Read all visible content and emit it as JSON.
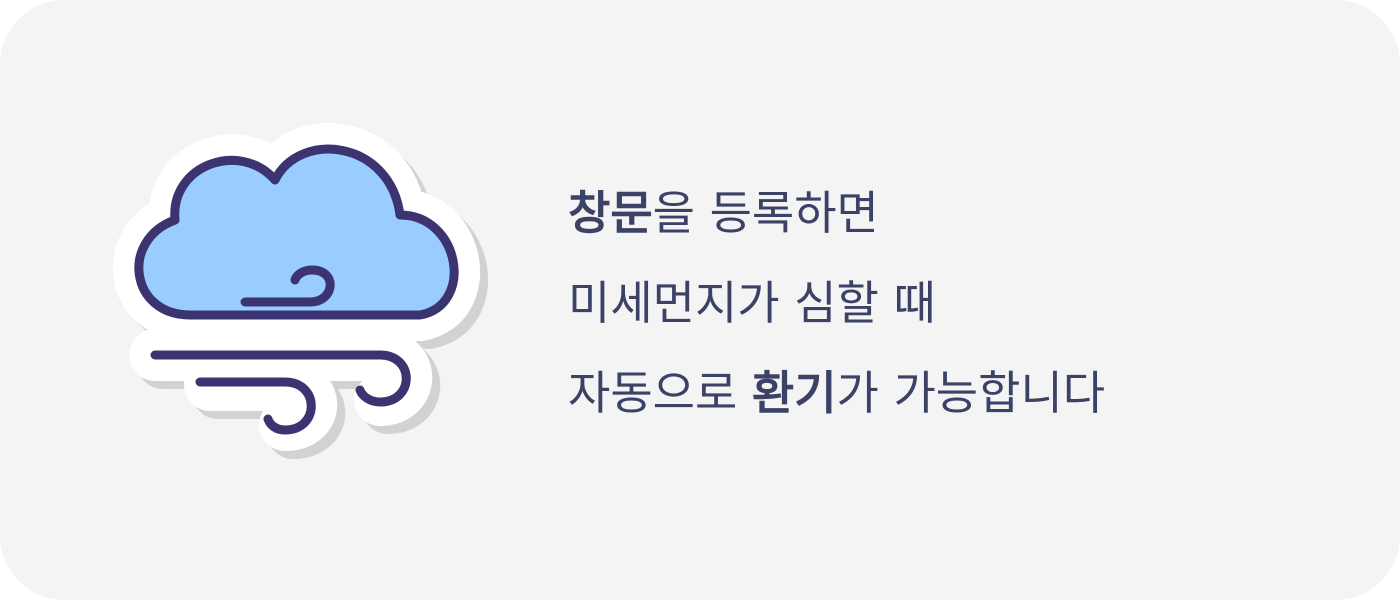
{
  "icon": {
    "name": "cloud-wind-icon",
    "colors": {
      "cloud_fill": "#99ccff",
      "outline": "#3b3470",
      "sticker_border": "#ffffff",
      "shadow": "#cfcfcf"
    }
  },
  "message": {
    "line1": {
      "bold": "창문",
      "rest": "을 등록하면"
    },
    "line2": "미세먼지가 심할 때",
    "line3": {
      "before": "자동으로 ",
      "bold": "환기",
      "rest": "가 가능합니다"
    },
    "text_color": "#3b4266"
  },
  "card": {
    "background": "#f4f4f5"
  }
}
